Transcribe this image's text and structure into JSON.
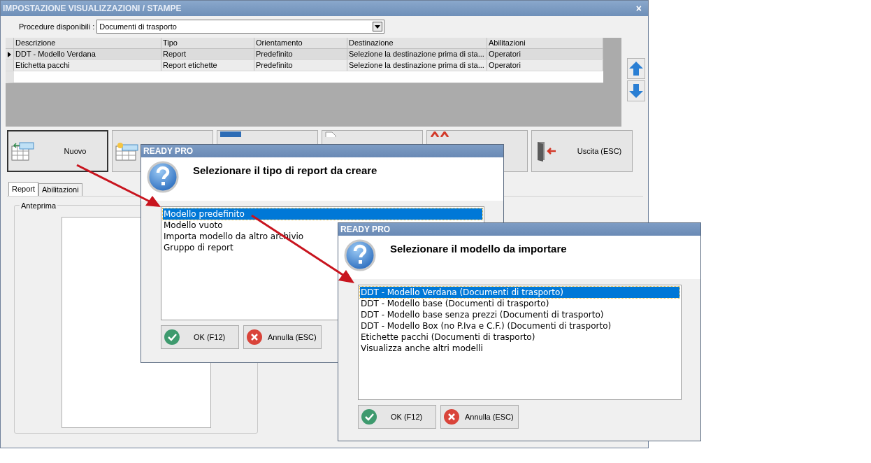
{
  "window": {
    "title": "IMPOSTAZIONE VISUALIZZAZIONI / STAMPE",
    "close": "×"
  },
  "procedure": {
    "label": "Procedure disponibili :",
    "value": "Documenti di trasporto"
  },
  "table": {
    "columns": [
      "Descrizione",
      "Tipo",
      "Orientamento",
      "Destinazione",
      "Abilitazioni"
    ],
    "rows": [
      {
        "selected": true,
        "cells": [
          "DDT - Modello Verdana",
          "Report",
          "Predefinito",
          "Selezione la destinazione prima di sta...",
          "Operatori"
        ]
      },
      {
        "selected": false,
        "cells": [
          "Etichetta pacchi",
          "Report etichette",
          "Predefinito",
          "Selezione la destinazione prima di sta...",
          "Operatori"
        ]
      }
    ]
  },
  "toolbar": [
    {
      "kind": "new",
      "label": "Nuovo"
    },
    {
      "kind": "grid-star"
    },
    {
      "kind": "blue"
    },
    {
      "kind": "doc"
    },
    {
      "kind": "delete"
    },
    {
      "kind": "exit",
      "label": "Uscita (ESC)"
    }
  ],
  "tabs": [
    {
      "label": "Report",
      "selected": true
    },
    {
      "label": "Abilitazioni",
      "selected": false
    }
  ],
  "preview_group": {
    "title": "Anteprima"
  },
  "dialogs": [
    {
      "title": "READY PRO",
      "heading": "Selezionare il tipo di report da creare",
      "items": [
        {
          "label": "Modello predefinito",
          "selected": true
        },
        {
          "label": "Modello vuoto",
          "selected": false
        },
        {
          "label": "Importa modello da altro archivio",
          "selected": false
        },
        {
          "label": "Gruppo di report",
          "selected": false
        }
      ],
      "ok": "OK (F12)",
      "cancel": "Annulla (ESC)"
    },
    {
      "title": "READY PRO",
      "heading": "Selezionare il modello da importare",
      "items": [
        {
          "label": "DDT - Modello Verdana (Documenti di trasporto)",
          "selected": true
        },
        {
          "label": "DDT - Modello base (Documenti di trasporto)",
          "selected": false
        },
        {
          "label": "DDT - Modello base senza prezzi (Documenti di trasporto)",
          "selected": false
        },
        {
          "label": "DDT - Modello Box (no P.Iva e C.F.) (Documenti di trasporto)",
          "selected": false
        },
        {
          "label": "Etichette pacchi (Documenti di trasporto)",
          "selected": false
        },
        {
          "label": "Visualizza anche altri modelli",
          "selected": false
        }
      ],
      "ok": "OK (F12)",
      "cancel": "Annulla (ESC)"
    }
  ]
}
